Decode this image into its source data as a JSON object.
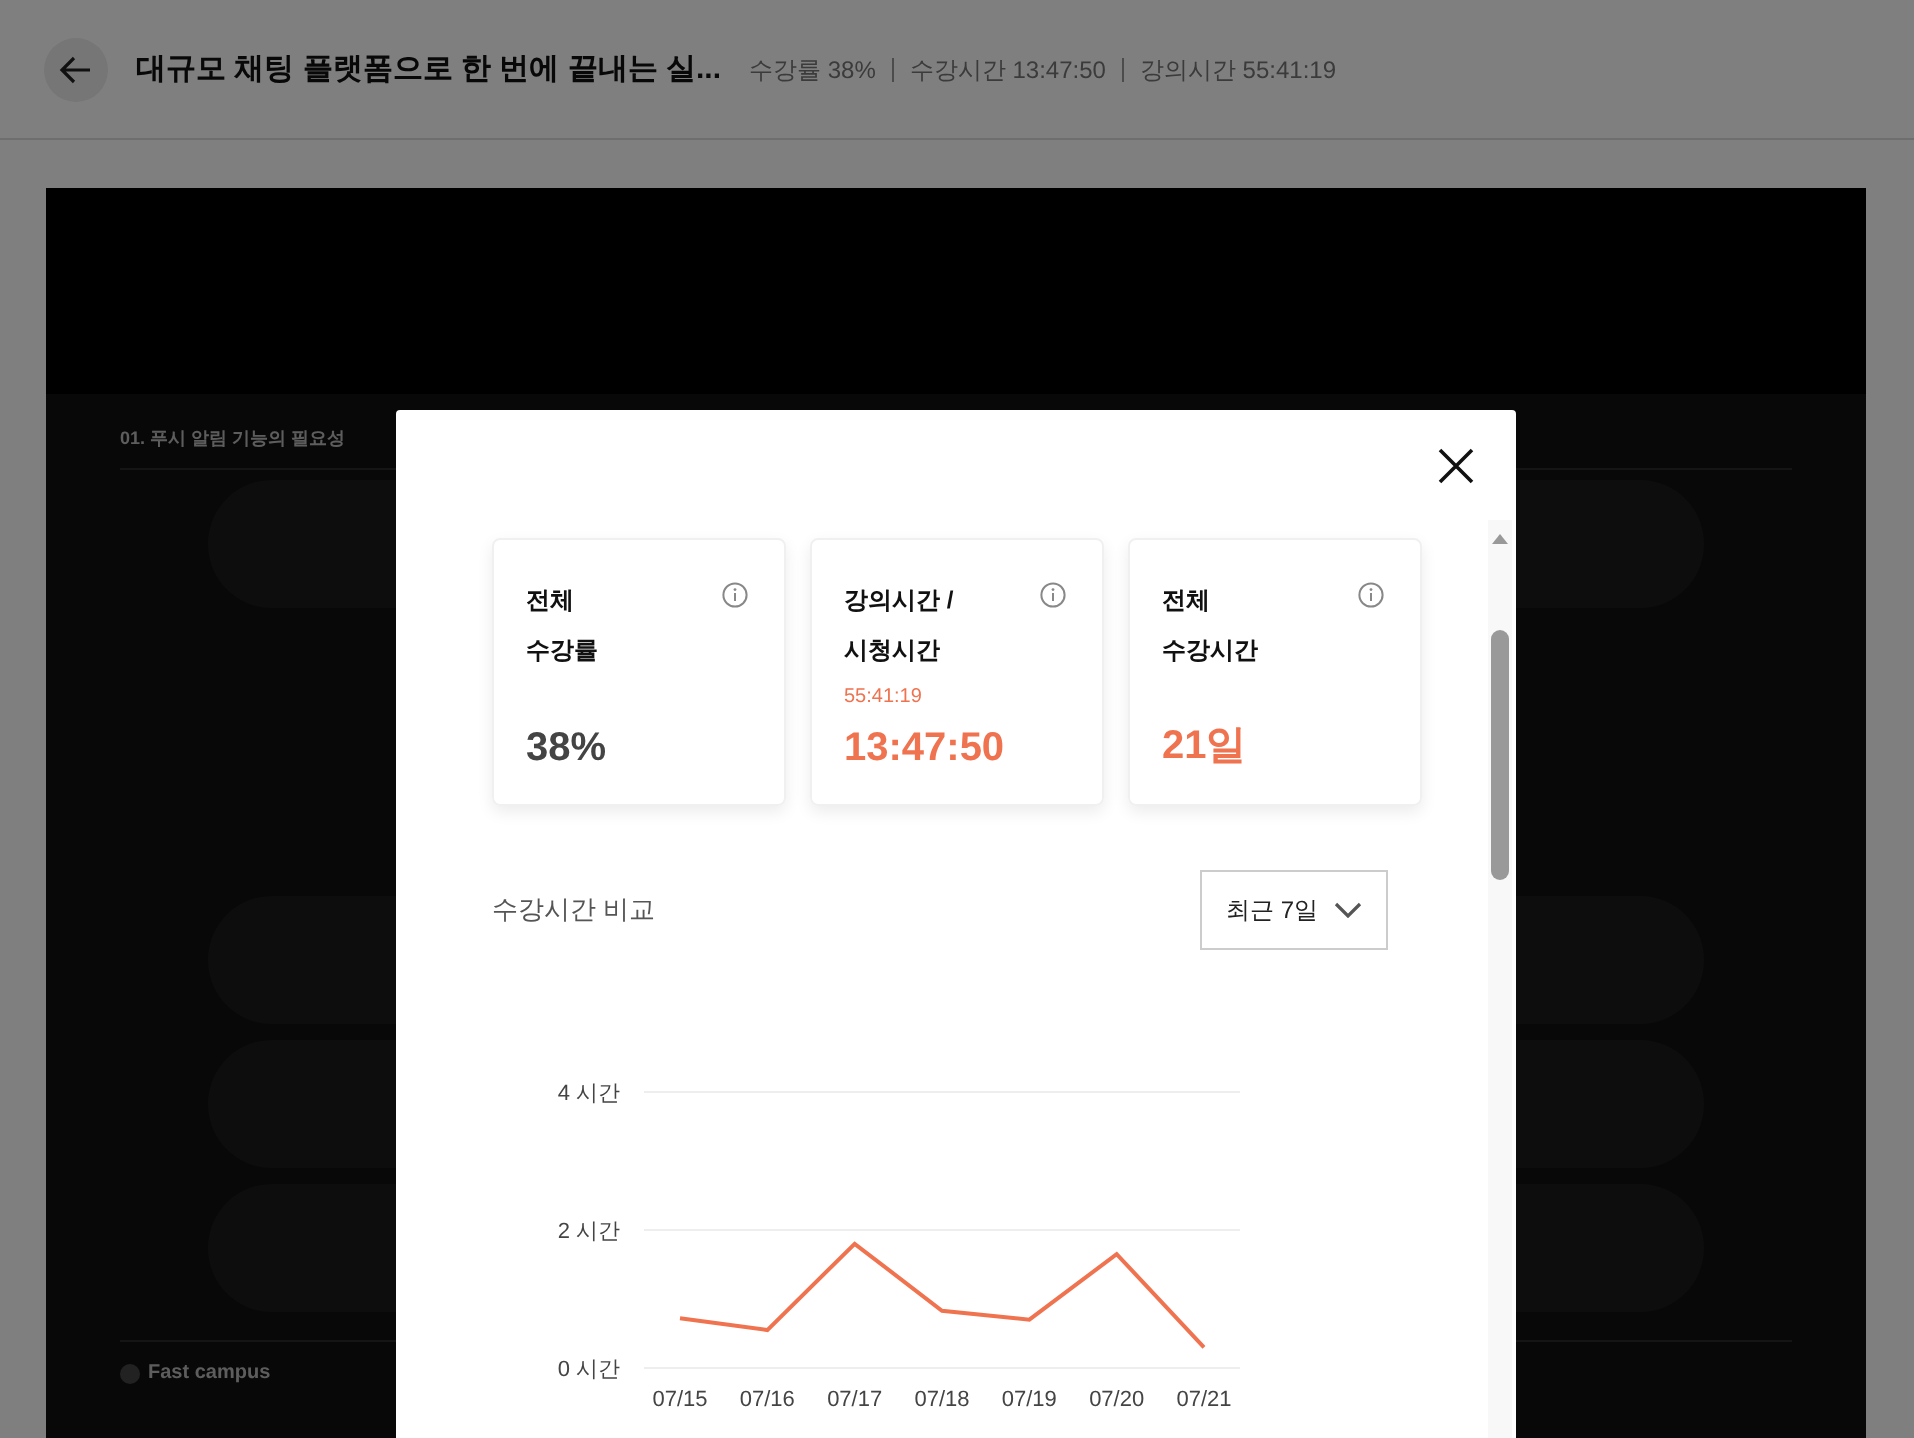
{
  "header": {
    "title": "대규모 채팅 플랫폼으로 한 번에 끝내는 실...",
    "stats": [
      {
        "label": "수강률",
        "value": "38%"
      },
      {
        "label": "수강시간",
        "value": "13:47:50"
      },
      {
        "label": "강의시간",
        "value": "55:41:19"
      }
    ]
  },
  "slide": {
    "title": "01. 푸시 알림 기능의 필요성",
    "footer": "Fast campus"
  },
  "modal": {
    "cards": [
      {
        "lines": [
          "전체",
          "수강률"
        ],
        "value": "38%",
        "accent": false
      },
      {
        "lines": [
          "강의시간 /",
          "시청시간"
        ],
        "sub": "55:41:19",
        "value": "13:47:50",
        "accent": true
      },
      {
        "lines": [
          "전체",
          "수강시간"
        ],
        "value": "21일",
        "accent": true
      }
    ],
    "section_title": "수강시간 비교",
    "period": "최근 7일",
    "chart_data": {
      "type": "line",
      "categories": [
        "07/15",
        "07/16",
        "07/17",
        "07/18",
        "07/19",
        "07/20",
        "07/21"
      ],
      "series": [
        {
          "color": "#f07350",
          "values": [
            0.72,
            0.55,
            1.8,
            0.83,
            0.7,
            1.65,
            0.3
          ]
        }
      ],
      "ylim": [
        0,
        4
      ],
      "yticks": [
        {
          "value": 0,
          "label": "0 시간"
        },
        {
          "value": 2,
          "label": "2 시간"
        },
        {
          "value": 4,
          "label": "4 시간"
        }
      ]
    }
  }
}
